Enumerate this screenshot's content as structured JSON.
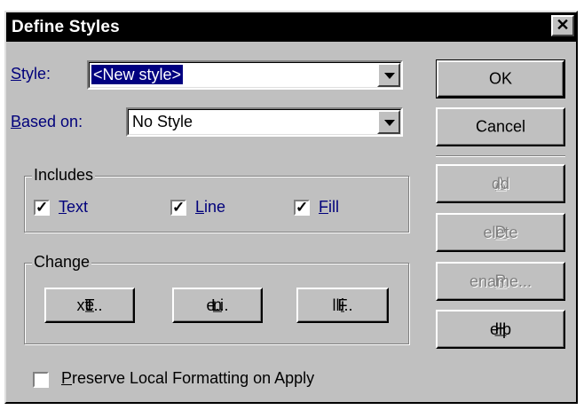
{
  "title": "Define Styles",
  "close_glyph": "✕",
  "style_field": {
    "label_accel": "S",
    "label_rest": "tyle:",
    "value": "<New style>"
  },
  "based_on_field": {
    "label_accel": "B",
    "label_rest": "ased on:",
    "value": "No Style"
  },
  "includes": {
    "title": "Includes",
    "items": [
      {
        "accel": "T",
        "rest": "ext",
        "checked": true
      },
      {
        "accel": "L",
        "rest": "ine",
        "checked": true
      },
      {
        "accel": "F",
        "rest": "ill",
        "checked": true
      }
    ]
  },
  "change": {
    "title": "Change",
    "text_btn": {
      "pre": "T",
      "accel": "e",
      "post": "xt..."
    },
    "line_btn": {
      "pre": "Li",
      "accel": "n",
      "post": "e..."
    },
    "fill_btn": {
      "pre": "F",
      "accel": "i",
      "post": "ll..."
    }
  },
  "preserve": {
    "accel": "P",
    "rest": "reserve Local Formatting on Apply",
    "checked": false
  },
  "buttons": {
    "ok": "OK",
    "cancel": "Cancel",
    "add": {
      "accel": "A",
      "rest": "dd"
    },
    "delete": {
      "accel": "D",
      "rest": "elete"
    },
    "rename": {
      "accel": "R",
      "rest": "ename..."
    },
    "help": {
      "accel": "H",
      "rest": "elp"
    }
  },
  "check_glyph": "✓"
}
